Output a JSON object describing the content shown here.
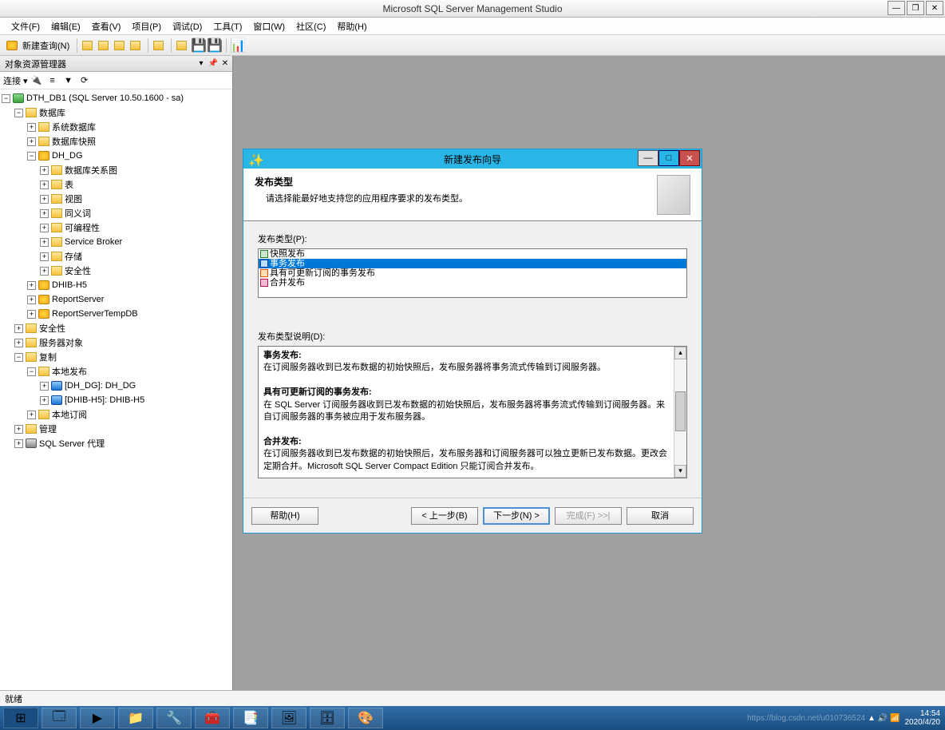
{
  "app_title": "Microsoft SQL Server Management Studio",
  "menu": [
    "文件(F)",
    "编辑(E)",
    "查看(V)",
    "项目(P)",
    "调试(D)",
    "工具(T)",
    "窗口(W)",
    "社区(C)",
    "帮助(H)"
  ],
  "toolbar": {
    "new_query": "新建查询(N)"
  },
  "sidebar": {
    "title": "对象资源管理器",
    "connect_label": "连接 ▾",
    "root": "DTH_DB1 (SQL Server 10.50.1600 - sa)",
    "nodes": {
      "databases": "数据库",
      "sys_db": "系统数据库",
      "db_snap": "数据库快照",
      "dh_dg": "DH_DG",
      "diagrams": "数据库关系图",
      "tables": "表",
      "views": "视图",
      "synonyms": "同义词",
      "programmability": "可编程性",
      "service_broker": "Service Broker",
      "storage": "存储",
      "security_db": "安全性",
      "dhib": "DHIB-H5",
      "report": "ReportServer",
      "report_temp": "ReportServerTempDB",
      "security": "安全性",
      "server_obj": "服务器对象",
      "replication": "复制",
      "local_pub": "本地发布",
      "pub1": "[DH_DG]: DH_DG",
      "pub2": "[DHIB-H5]: DHIB-H5",
      "local_sub": "本地订阅",
      "management": "管理",
      "agent": "SQL Server 代理"
    }
  },
  "dialog": {
    "title": "新建发布向导",
    "header_title": "发布类型",
    "header_sub": "请选择能最好地支持您的应用程序要求的发布类型。",
    "list_label": "发布类型(P):",
    "options": [
      "快照发布",
      "事务发布",
      "具有可更新订阅的事务发布",
      "合并发布"
    ],
    "selected_index": 1,
    "desc_label": "发布类型说明(D):",
    "desc": {
      "t1": "事务发布:",
      "d1": "在订阅服务器收到已发布数据的初始快照后，发布服务器将事务流式传输到订阅服务器。",
      "t2": "具有可更新订阅的事务发布:",
      "d2": "在 SQL Server 订阅服务器收到已发布数据的初始快照后，发布服务器将事务流式传输到订阅服务器。来自订阅服务器的事务被应用于发布服务器。",
      "t3": "合并发布:",
      "d3": "在订阅服务器收到已发布数据的初始快照后，发布服务器和订阅服务器可以独立更新已发布数据。更改会定期合并。Microsoft SQL Server Compact Edition 只能订阅合并发布。"
    },
    "btn_help": "帮助(H)",
    "btn_back": "< 上一步(B)",
    "btn_next": "下一步(N) >",
    "btn_finish": "完成(F) >>|",
    "btn_cancel": "取消"
  },
  "status": "就绪",
  "tray": {
    "time": "14:54",
    "date": "2020/4/20"
  },
  "watermark": "https://blog.csdn.net/u010736524"
}
